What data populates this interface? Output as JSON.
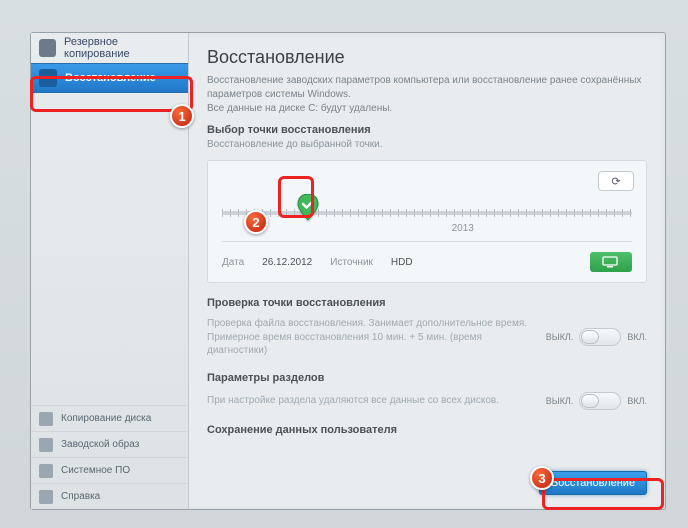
{
  "sidebar": {
    "top": [
      {
        "label": "Резервное копирование",
        "icon": "backup-icon"
      },
      {
        "label": "Восстановление",
        "icon": "restore-icon",
        "active": true
      }
    ],
    "bottom": [
      {
        "label": "Копирование диска",
        "icon": "disk-copy-icon"
      },
      {
        "label": "Заводской образ",
        "icon": "factory-image-icon"
      },
      {
        "label": "Системное ПО",
        "icon": "system-sw-icon"
      },
      {
        "label": "Справка",
        "icon": "help-icon"
      }
    ]
  },
  "main": {
    "title": "Восстановление",
    "subtitle": "Восстановление заводских параметров компьютера или восстановление ранее сохранённых параметров системы Windows.",
    "warning": "Все данные на диске C: будут удалены.",
    "restore_point": {
      "heading": "Выбор точки восстановления",
      "sub": "Восстановление до выбранной точки.",
      "year": "2013",
      "date_label": "Дата",
      "date_value": "26.12.2012",
      "source_label": "Источник",
      "source_value": "HDD"
    },
    "check": {
      "heading": "Проверка точки восстановления",
      "desc": "Проверка файла восстановления. Занимает дополнительное время. Примерное время восстановления 10 мин. + 5 мин. (время диагностики)"
    },
    "partitions": {
      "heading": "Параметры разделов",
      "desc": "При настройке раздела удаляются все данные со всех дисков."
    },
    "userdata": {
      "heading": "Сохранение данных пользователя"
    },
    "toggle": {
      "off": "ВЫКЛ.",
      "on": "ВКЛ."
    },
    "primary_button": "Восстановление"
  },
  "annotations": [
    "1",
    "2",
    "3"
  ]
}
